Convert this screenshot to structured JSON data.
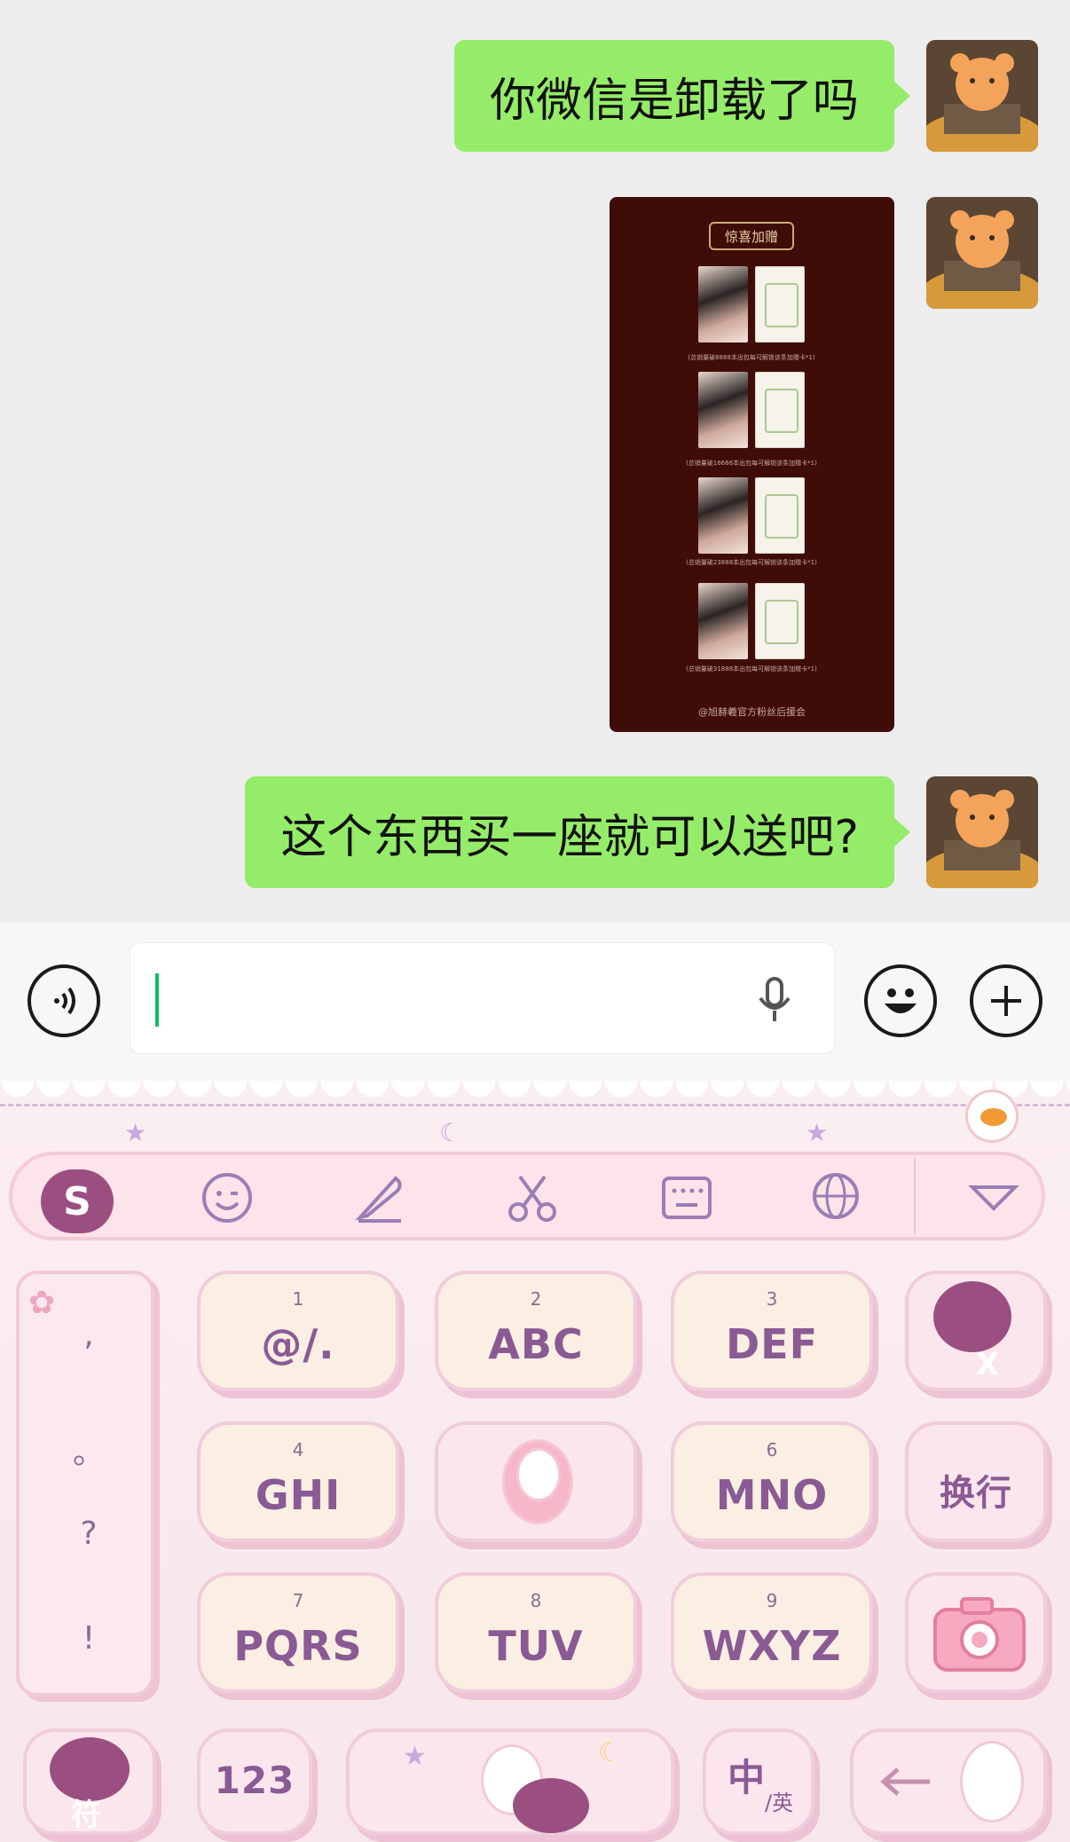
{
  "chat": {
    "messages": [
      {
        "text": "你微信是卸载了吗",
        "from": "me",
        "kind": "text"
      },
      {
        "from": "me",
        "kind": "image",
        "image": {
          "title": "惊喜加赠",
          "captions": [
            "(总销量破8888本出包每可解锁该条加赠卡*1)",
            "(总销量破16666本出包每可解锁该条加赠卡*1)",
            "(总销量破23888本出包每可解锁该条加赠卡*1)",
            "(总销量破31888本出包每可解锁该条加赠卡*1)"
          ],
          "footer": "@旭赫羲官方粉丝后援会"
        }
      },
      {
        "text": "这个东西买一座就可以送吧?",
        "from": "me",
        "kind": "text"
      }
    ]
  },
  "input_bar": {
    "voice_icon": "voice-icon",
    "mic_icon": "mic-icon",
    "emoji_icon": "emoji-icon",
    "plus_icon": "plus-icon",
    "value": ""
  },
  "keyboard": {
    "toolbar": {
      "logo": "S",
      "icons": [
        "emoji-icon",
        "pen-icon",
        "scissors-icon",
        "keyboard-icon",
        "globe-icon",
        "collapse-icon"
      ]
    },
    "side_symbols": [
      ",",
      "。",
      "?",
      "!"
    ],
    "keys": [
      {
        "num": "1",
        "label": "@/."
      },
      {
        "num": "2",
        "label": "ABC"
      },
      {
        "num": "3",
        "label": "DEF"
      },
      {
        "num": "4",
        "label": "GHI"
      },
      {
        "num": "6",
        "label": "MNO"
      },
      {
        "num": "7",
        "label": "PQRS"
      },
      {
        "num": "8",
        "label": "TUV"
      },
      {
        "num": "9",
        "label": "WXYZ"
      }
    ],
    "newline_label": "换行",
    "symbol_label": "符",
    "num_label": "123",
    "lang_main": "中",
    "lang_sub": "/英",
    "delete_label": "X"
  }
}
